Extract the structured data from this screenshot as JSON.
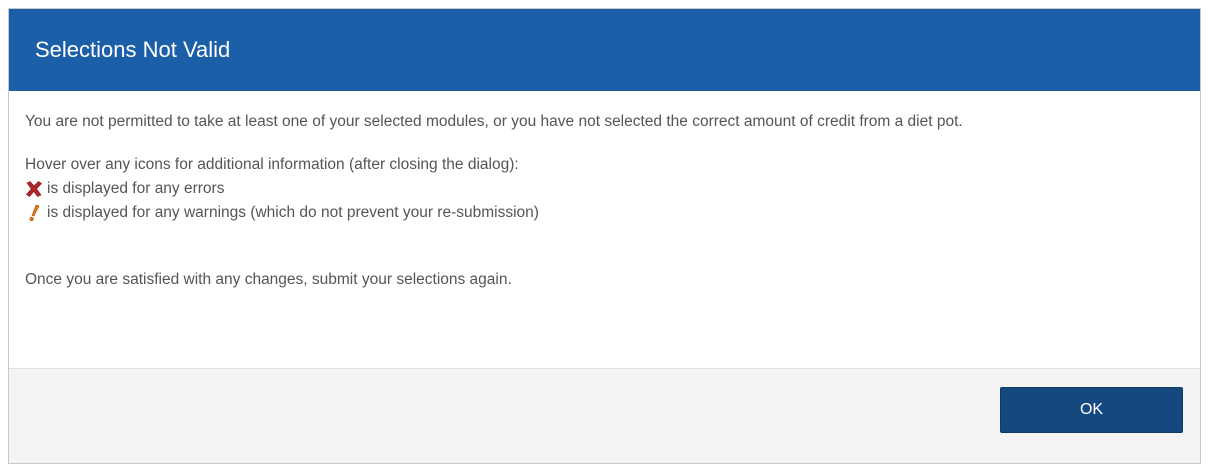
{
  "dialog": {
    "title": "Selections Not Valid",
    "paragraph1": "You are not permitted to take at least one of your selected modules, or you have not selected the correct amount of credit from a diet pot.",
    "hover_text": "Hover over any icons for additional information (after closing the dialog):",
    "error_text": "is displayed for any errors",
    "warning_text": "is displayed for any warnings (which do not prevent your re-submission)",
    "closing_text": "Once you are satisfied with any changes, submit your selections again.",
    "ok_label": "OK"
  },
  "icons": {
    "error": "cross-icon",
    "warning": "exclamation-icon"
  },
  "colors": {
    "title_bar": "#1b5fa8",
    "button": "#15487f",
    "error_icon": "#b3242b",
    "warning_icon": "#e07a1b"
  }
}
